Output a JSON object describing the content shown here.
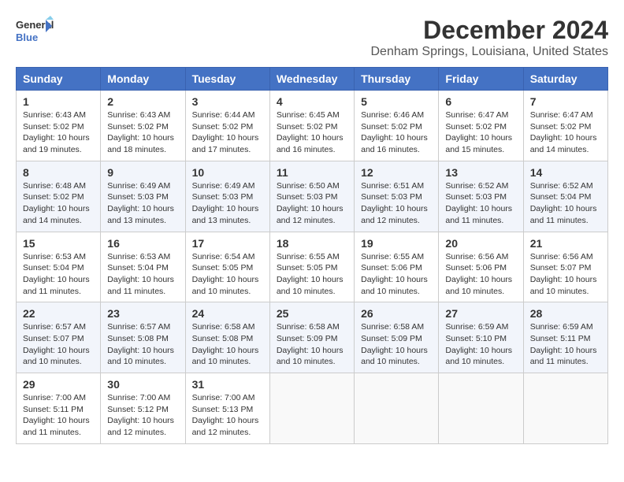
{
  "logo": {
    "line1": "General",
    "line2": "Blue"
  },
  "title": "December 2024",
  "subtitle": "Denham Springs, Louisiana, United States",
  "days_header": [
    "Sunday",
    "Monday",
    "Tuesday",
    "Wednesday",
    "Thursday",
    "Friday",
    "Saturday"
  ],
  "weeks": [
    [
      {
        "day": "1",
        "info": "Sunrise: 6:43 AM\nSunset: 5:02 PM\nDaylight: 10 hours\nand 19 minutes."
      },
      {
        "day": "2",
        "info": "Sunrise: 6:43 AM\nSunset: 5:02 PM\nDaylight: 10 hours\nand 18 minutes."
      },
      {
        "day": "3",
        "info": "Sunrise: 6:44 AM\nSunset: 5:02 PM\nDaylight: 10 hours\nand 17 minutes."
      },
      {
        "day": "4",
        "info": "Sunrise: 6:45 AM\nSunset: 5:02 PM\nDaylight: 10 hours\nand 16 minutes."
      },
      {
        "day": "5",
        "info": "Sunrise: 6:46 AM\nSunset: 5:02 PM\nDaylight: 10 hours\nand 16 minutes."
      },
      {
        "day": "6",
        "info": "Sunrise: 6:47 AM\nSunset: 5:02 PM\nDaylight: 10 hours\nand 15 minutes."
      },
      {
        "day": "7",
        "info": "Sunrise: 6:47 AM\nSunset: 5:02 PM\nDaylight: 10 hours\nand 14 minutes."
      }
    ],
    [
      {
        "day": "8",
        "info": "Sunrise: 6:48 AM\nSunset: 5:02 PM\nDaylight: 10 hours\nand 14 minutes."
      },
      {
        "day": "9",
        "info": "Sunrise: 6:49 AM\nSunset: 5:03 PM\nDaylight: 10 hours\nand 13 minutes."
      },
      {
        "day": "10",
        "info": "Sunrise: 6:49 AM\nSunset: 5:03 PM\nDaylight: 10 hours\nand 13 minutes."
      },
      {
        "day": "11",
        "info": "Sunrise: 6:50 AM\nSunset: 5:03 PM\nDaylight: 10 hours\nand 12 minutes."
      },
      {
        "day": "12",
        "info": "Sunrise: 6:51 AM\nSunset: 5:03 PM\nDaylight: 10 hours\nand 12 minutes."
      },
      {
        "day": "13",
        "info": "Sunrise: 6:52 AM\nSunset: 5:03 PM\nDaylight: 10 hours\nand 11 minutes."
      },
      {
        "day": "14",
        "info": "Sunrise: 6:52 AM\nSunset: 5:04 PM\nDaylight: 10 hours\nand 11 minutes."
      }
    ],
    [
      {
        "day": "15",
        "info": "Sunrise: 6:53 AM\nSunset: 5:04 PM\nDaylight: 10 hours\nand 11 minutes."
      },
      {
        "day": "16",
        "info": "Sunrise: 6:53 AM\nSunset: 5:04 PM\nDaylight: 10 hours\nand 11 minutes."
      },
      {
        "day": "17",
        "info": "Sunrise: 6:54 AM\nSunset: 5:05 PM\nDaylight: 10 hours\nand 10 minutes."
      },
      {
        "day": "18",
        "info": "Sunrise: 6:55 AM\nSunset: 5:05 PM\nDaylight: 10 hours\nand 10 minutes."
      },
      {
        "day": "19",
        "info": "Sunrise: 6:55 AM\nSunset: 5:06 PM\nDaylight: 10 hours\nand 10 minutes."
      },
      {
        "day": "20",
        "info": "Sunrise: 6:56 AM\nSunset: 5:06 PM\nDaylight: 10 hours\nand 10 minutes."
      },
      {
        "day": "21",
        "info": "Sunrise: 6:56 AM\nSunset: 5:07 PM\nDaylight: 10 hours\nand 10 minutes."
      }
    ],
    [
      {
        "day": "22",
        "info": "Sunrise: 6:57 AM\nSunset: 5:07 PM\nDaylight: 10 hours\nand 10 minutes."
      },
      {
        "day": "23",
        "info": "Sunrise: 6:57 AM\nSunset: 5:08 PM\nDaylight: 10 hours\nand 10 minutes."
      },
      {
        "day": "24",
        "info": "Sunrise: 6:58 AM\nSunset: 5:08 PM\nDaylight: 10 hours\nand 10 minutes."
      },
      {
        "day": "25",
        "info": "Sunrise: 6:58 AM\nSunset: 5:09 PM\nDaylight: 10 hours\nand 10 minutes."
      },
      {
        "day": "26",
        "info": "Sunrise: 6:58 AM\nSunset: 5:09 PM\nDaylight: 10 hours\nand 10 minutes."
      },
      {
        "day": "27",
        "info": "Sunrise: 6:59 AM\nSunset: 5:10 PM\nDaylight: 10 hours\nand 10 minutes."
      },
      {
        "day": "28",
        "info": "Sunrise: 6:59 AM\nSunset: 5:11 PM\nDaylight: 10 hours\nand 11 minutes."
      }
    ],
    [
      {
        "day": "29",
        "info": "Sunrise: 7:00 AM\nSunset: 5:11 PM\nDaylight: 10 hours\nand 11 minutes."
      },
      {
        "day": "30",
        "info": "Sunrise: 7:00 AM\nSunset: 5:12 PM\nDaylight: 10 hours\nand 12 minutes."
      },
      {
        "day": "31",
        "info": "Sunrise: 7:00 AM\nSunset: 5:13 PM\nDaylight: 10 hours\nand 12 minutes."
      },
      {
        "day": "",
        "info": ""
      },
      {
        "day": "",
        "info": ""
      },
      {
        "day": "",
        "info": ""
      },
      {
        "day": "",
        "info": ""
      }
    ]
  ]
}
